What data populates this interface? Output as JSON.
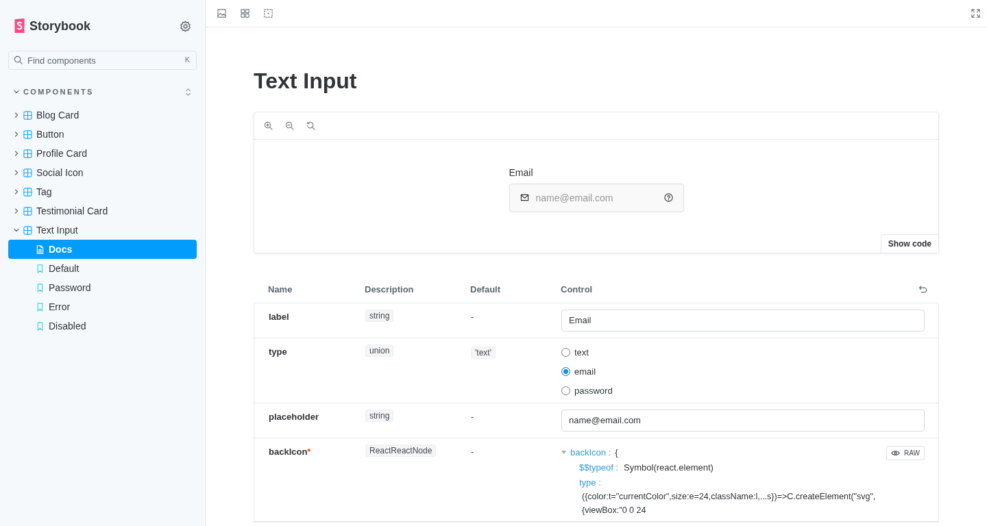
{
  "sidebar": {
    "brand": "Storybook",
    "search": {
      "placeholder": "Find components",
      "shortcut": "K"
    },
    "section": {
      "title": "COMPONENTS",
      "expanded": true
    },
    "tree": [
      {
        "label": "Blog Card",
        "expanded": false
      },
      {
        "label": "Button",
        "expanded": false
      },
      {
        "label": "Profile Card",
        "expanded": false
      },
      {
        "label": "Social Icon",
        "expanded": false
      },
      {
        "label": "Tag",
        "expanded": false
      },
      {
        "label": "Testimonial Card",
        "expanded": false
      },
      {
        "label": "Text Input",
        "expanded": true,
        "children": [
          {
            "label": "Docs",
            "kind": "docs",
            "selected": true
          },
          {
            "label": "Default",
            "kind": "story",
            "selected": false
          },
          {
            "label": "Password",
            "kind": "story",
            "selected": false
          },
          {
            "label": "Error",
            "kind": "story",
            "selected": false
          },
          {
            "label": "Disabled",
            "kind": "story",
            "selected": false
          }
        ]
      }
    ]
  },
  "docs": {
    "title": "Text Input",
    "preview": {
      "label": "Email",
      "placeholder": "name@email.com",
      "show_code": "Show code"
    },
    "args_table": {
      "columns": [
        "Name",
        "Description",
        "Default",
        "Control"
      ],
      "rows": [
        {
          "name": "label",
          "type": "string",
          "default": "-",
          "control": {
            "kind": "text",
            "value": "Email"
          }
        },
        {
          "name": "type",
          "type": "union",
          "default": "'text'",
          "control": {
            "kind": "radio",
            "options": [
              {
                "label": "text",
                "selected": false
              },
              {
                "label": "email",
                "selected": true
              },
              {
                "label": "password",
                "selected": false
              }
            ]
          }
        },
        {
          "name": "placeholder",
          "type": "string",
          "default": "-",
          "control": {
            "kind": "text",
            "value": "name@email.com"
          }
        },
        {
          "name": "backIcon",
          "required_mark": "*",
          "type": "ReactReactNode",
          "default": "-",
          "control": {
            "kind": "object",
            "raw_label": "RAW",
            "key": "backIcon :",
            "brace": "{",
            "expanded": true,
            "entries": [
              {
                "key": "$$typeof :",
                "value": "Symbol(react.element)"
              },
              {
                "key": "type :",
                "value_lines": [
                  "({color:t=\"currentColor\",size:e=24,className:l,...s})=>C.createElement(\"svg\",",
                  "{viewBox:\"0 0 24"
                ]
              }
            ]
          }
        }
      ]
    }
  }
}
